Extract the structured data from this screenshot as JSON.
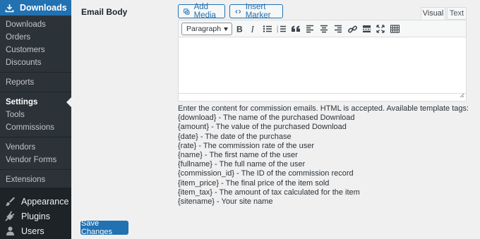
{
  "sidebar": {
    "header": "Downloads",
    "sub_items": [
      {
        "label": "Downloads"
      },
      {
        "label": "Orders"
      },
      {
        "label": "Customers"
      },
      {
        "label": "Discounts"
      },
      {
        "label": "Reports"
      },
      {
        "label": "Settings"
      },
      {
        "label": "Tools"
      },
      {
        "label": "Commissions"
      },
      {
        "label": "Vendors"
      },
      {
        "label": "Vendor Forms"
      },
      {
        "label": "Extensions"
      }
    ],
    "current": "Settings",
    "top_items": [
      {
        "label": "Appearance",
        "icon": "paintbrush-icon"
      },
      {
        "label": "Plugins",
        "icon": "plug-icon"
      },
      {
        "label": "Users",
        "icon": "user-icon"
      }
    ]
  },
  "field": {
    "label": "Email Body",
    "add_media": "Add Media",
    "insert_marker": "Insert Marker",
    "tabs": [
      "Visual",
      "Text"
    ],
    "active_tab": "Visual",
    "format_select": "Paragraph",
    "toolbar_icons": [
      "bold-icon",
      "italic-icon",
      "bullet-list-icon",
      "numbered-list-icon",
      "blockquote-icon",
      "align-left-icon",
      "align-center-icon",
      "align-right-icon",
      "link-icon",
      "read-more-icon",
      "fullscreen-icon",
      "toolbar-toggle-icon"
    ],
    "content": ""
  },
  "help": {
    "lines": [
      "Enter the content for commission emails. HTML is accepted. Available template tags:",
      "{download} - The name of the purchased Download",
      "{amount} - The value of the purchased Download",
      "{date} - The date of the purchase",
      "{rate} - The commission rate of the user",
      "{name} - The first name of the user",
      "{fullname} - The full name of the user",
      "{commission_id} - The ID of the commission record",
      "{item_price} - The final price of the item sold",
      "{item_tax} - The amount of tax calculated for the item",
      "{sitename} - Your site name"
    ]
  },
  "actions": {
    "save": "Save Changes"
  },
  "colors": {
    "accent": "#2271b1",
    "sidebar": "#1d2327",
    "submenu": "#2c3338",
    "background": "#f0f0f1"
  }
}
